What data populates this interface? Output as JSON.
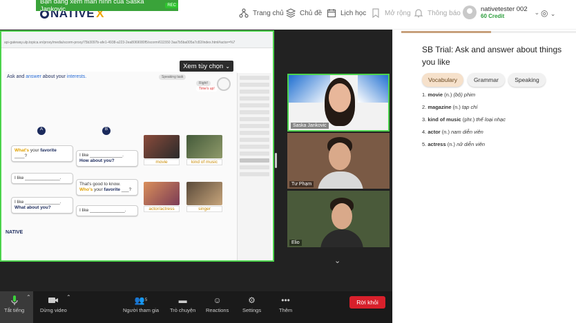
{
  "nav": {
    "logo_text": "NATIVE",
    "logo_x": "X",
    "items": [
      {
        "label": "Trang chủ",
        "icon": "home-network-icon"
      },
      {
        "label": "Chủ đề",
        "icon": "layers-icon"
      },
      {
        "label": "Lịch học",
        "icon": "calendar-icon"
      },
      {
        "label": "Mở rộng",
        "icon": "bookmark-icon"
      },
      {
        "label": "Thông báo",
        "icon": "bell-icon"
      }
    ],
    "username": "nativetester 002",
    "credit": "60 Credit"
  },
  "share": {
    "banner_text": "Bạn đang xem màn hình của Saska Jankovic",
    "rec_label": "REC",
    "view_options_label": "Xem tùy chọn",
    "browser_url": "api-gateway.ulp.topica.vn/proxy/media/scorm-proxy/75b3097b-afe1-4938-a223-2ea8069080f5/scorm/611550 3aa7b5ba005a7c82/index.html#actor=%7",
    "lesson": {
      "instruction_prefix": "Ask",
      "instruction_and": "and",
      "instruction_answer": "answer",
      "instruction_about": "about your",
      "instruction_interests": "interests.",
      "speaking_task": "Speaking task",
      "tag_right": "Right!",
      "tag_time": "Time's up!",
      "speaker_a": "A",
      "speaker_b": "B",
      "bubble1_what": "What's",
      "bubble1_rest": "your",
      "bubble1_fav": "favorite",
      "bubble1_blank": "____?",
      "bubble2_line1": "I like _____________.",
      "bubble2_line2": "How about you?",
      "bubble3": "I like ______________.",
      "bubble4_line1": "That's good to know.",
      "bubble4_who": "Who's",
      "bubble4_rest": "your",
      "bubble4_fav": "favorite",
      "bubble4_blank": "___?",
      "bubble5_line1": "I like ______________.",
      "bubble5_line2": "What about you?",
      "bubble6": "I like ______________.",
      "cards": [
        "movie",
        "kind of music",
        "actor/actress",
        "singer"
      ],
      "slide_logo": "NATIVE"
    }
  },
  "participants": [
    {
      "name": "Saska Jankovic"
    },
    {
      "name": "Tư Phạm"
    },
    {
      "name": "Elio"
    }
  ],
  "toolbar": {
    "mic_label": "Tắt tiếng",
    "video_label": "Dừng video",
    "participants_label": "Người tham gia",
    "participants_count": "5",
    "chat_label": "Trò chuyện",
    "reactions_label": "Reactions",
    "settings_label": "Settings",
    "more_label": "Thêm",
    "leave_label": "Rời khỏi"
  },
  "panel": {
    "progress": 0.51,
    "title": "SB Trial: Ask and answer about things you like",
    "tabs": [
      "Vocabulary",
      "Grammar",
      "Speaking"
    ],
    "active_tab": "Vocabulary",
    "vocab": [
      {
        "num": "1.",
        "word": "movie",
        "pos": "(n.)",
        "meaning": "(bộ) phim"
      },
      {
        "num": "2.",
        "word": "magazine",
        "pos": "(n.)",
        "meaning": "tạp chí"
      },
      {
        "num": "3.",
        "word": "kind of music",
        "pos": "(phr.)",
        "meaning": "thể loại nhạc"
      },
      {
        "num": "4.",
        "word": "actor",
        "pos": "(n.)",
        "meaning": "nam diễn viên"
      },
      {
        "num": "5.",
        "word": "actress",
        "pos": "(n.)",
        "meaning": "nữ diễn viên"
      }
    ]
  }
}
